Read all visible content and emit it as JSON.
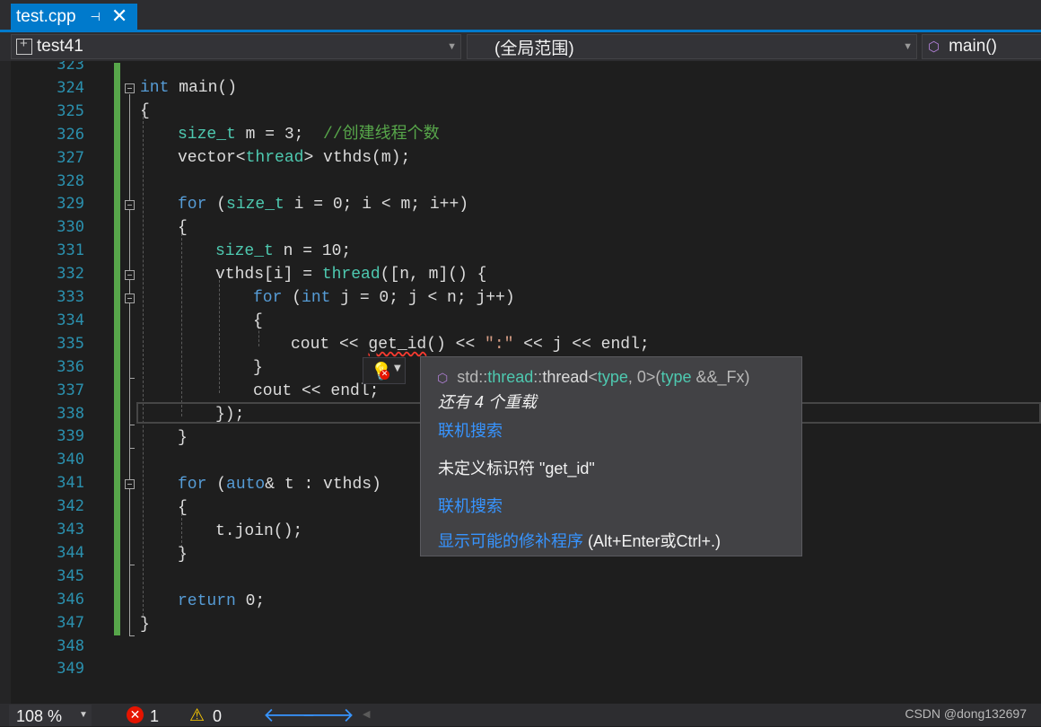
{
  "tab": {
    "title": "test.cpp",
    "pin": "⊣",
    "close": "✕"
  },
  "nav": {
    "project": "test41",
    "scope": "(全局范围)",
    "member": "main()"
  },
  "editor": {
    "line_numbers": [
      "323",
      "324",
      "325",
      "326",
      "327",
      "328",
      "329",
      "330",
      "331",
      "332",
      "333",
      "334",
      "335",
      "336",
      "337",
      "338",
      "339",
      "340",
      "341",
      "342",
      "343",
      "344",
      "345",
      "346",
      "347",
      "348",
      "349"
    ],
    "code": {
      "l324_kw": "int",
      "l324_rest": " main()",
      "l325": "{",
      "l326_ty": "size_t",
      "l326_rest": " m = 3;  ",
      "l326_cm": "//创建线程个数",
      "l327_a": "vector<",
      "l327_ty": "thread",
      "l327_b": "> vthds(m);",
      "l329_kw": "for",
      "l329_a": " (",
      "l329_ty": "size_t",
      "l329_b": " i = 0; i < m; i++)",
      "l330": "{",
      "l331_ty": "size_t",
      "l331_rest": " n = 10;",
      "l332_a": "vthds[i] = ",
      "l332_ty": "thread",
      "l332_b": "([n, m]() {",
      "l333_kw": "for",
      "l333_a": " (",
      "l333_kw2": "int",
      "l333_b": " j = 0; j < n; j++)",
      "l334": "{",
      "l335_a": "cout << ",
      "l335_err": "get_id",
      "l335_b": "() << ",
      "l335_st": "\":\"",
      "l335_c": " << j << endl;",
      "l336": "}",
      "l337": "cout << endl;",
      "l338": "});",
      "l339": "}",
      "l341_kw": "for",
      "l341_a": " (",
      "l341_kw2": "auto",
      "l341_b": "& t : vthds)",
      "l342": "{",
      "l343": "t.join();",
      "l344": "}",
      "l346_kw": "return",
      "l346_rest": " 0;",
      "l347": "}"
    }
  },
  "tooltip": {
    "sig_ns1": "std::",
    "sig_t1": "thread",
    "sig_ns2": "::",
    "sig_t2": "thread",
    "sig_lt": "<",
    "sig_t3": "type",
    "sig_mid": ", 0>(",
    "sig_t4": "type",
    "sig_end": " &&_Fx)",
    "overloads": "还有 4 个重载",
    "search1": "联机搜索",
    "error_text": "未定义标识符 \"get_id\"",
    "search2": "联机搜索",
    "fix_link": "显示可能的修补程序",
    "fix_keys": " (Alt+Enter或Ctrl+.)"
  },
  "status": {
    "zoom": "108 %",
    "errors": "1",
    "warnings": "0",
    "watermark": "CSDN @dong132697"
  },
  "colors": {
    "accent": "#007acc",
    "keyword": "#569cd6",
    "type": "#4ec9b0",
    "comment": "#57a64a",
    "link": "#3794ff"
  },
  "icons": [
    "pin-icon",
    "close-icon",
    "project-icon",
    "cube-icon",
    "lightbulb-icon",
    "error-icon",
    "warning-icon",
    "arrow-left-icon",
    "arrow-right-icon"
  ]
}
